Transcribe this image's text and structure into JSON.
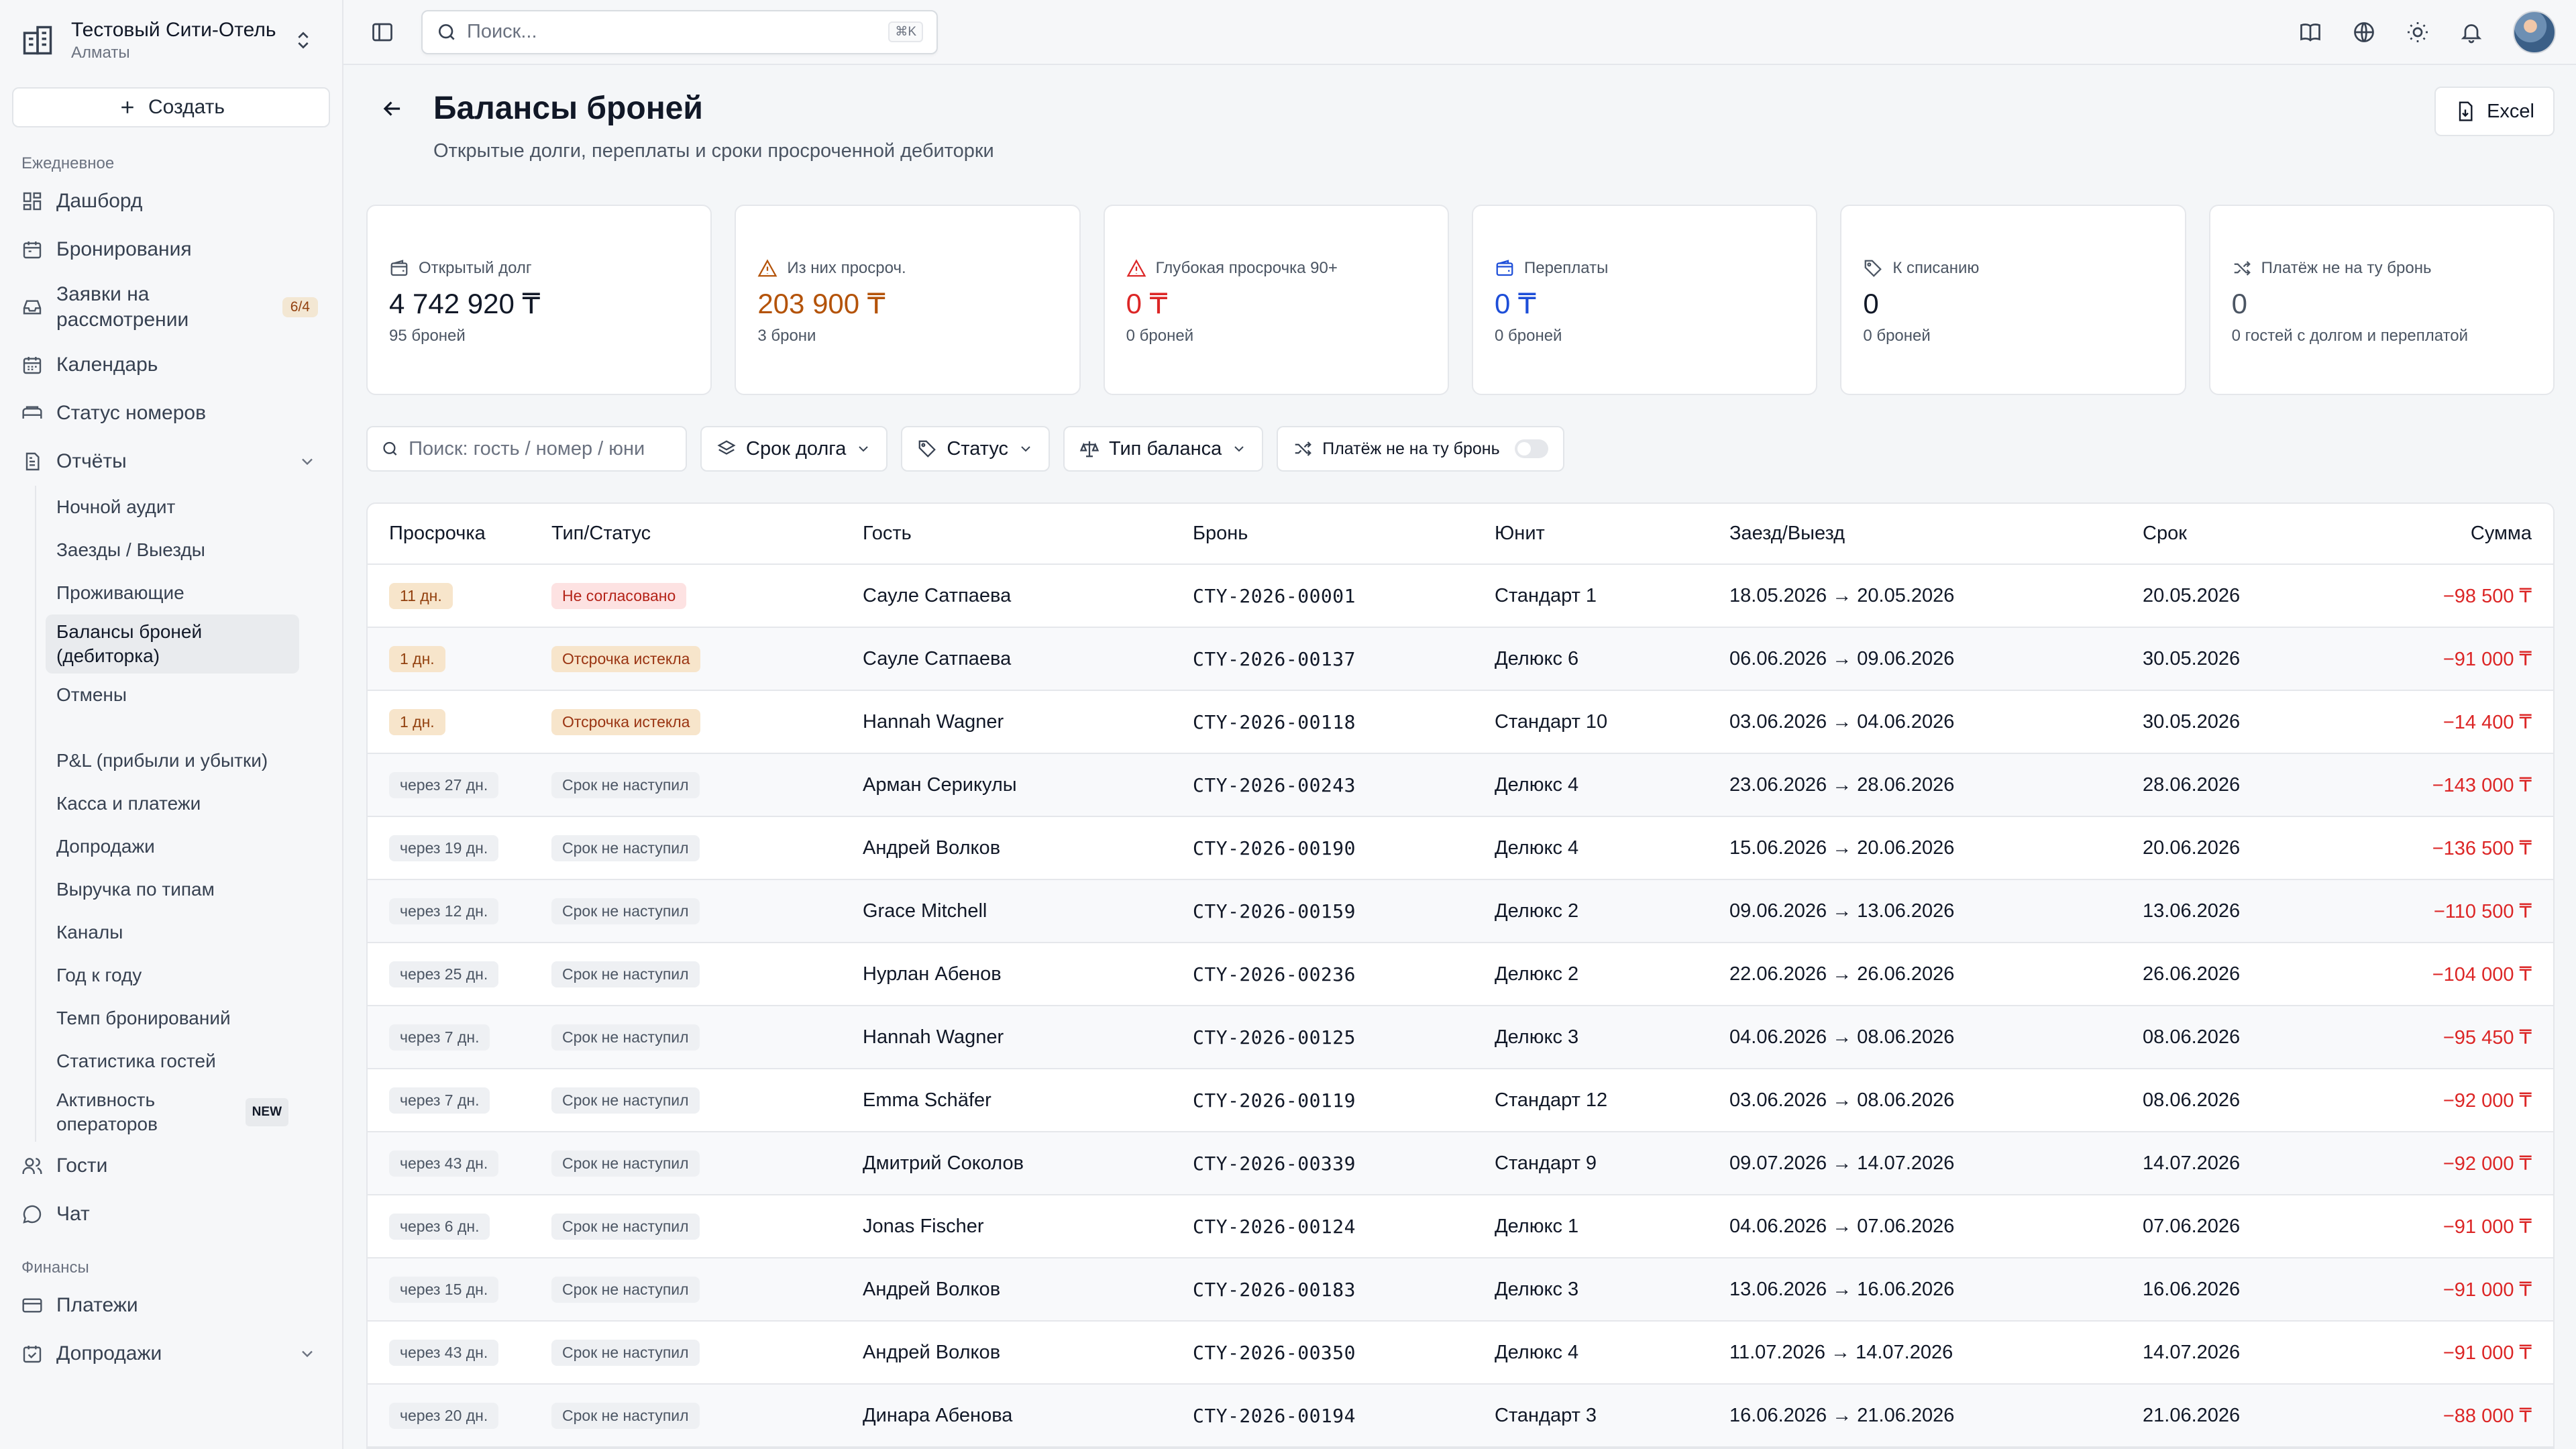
{
  "hotel": {
    "name": "Тестовый Сити-Отель",
    "city": "Алматы"
  },
  "sidebar": {
    "create_label": "Создать",
    "section_daily": "Ежедневное",
    "section_finance": "Финансы",
    "items": [
      {
        "label": "Дашборд",
        "icon": "dashboard-icon"
      },
      {
        "label": "Бронирования",
        "icon": "calendar-icon"
      },
      {
        "label": "Заявки на рассмотрении",
        "icon": "inbox-icon",
        "badge": "6/4"
      },
      {
        "label": "Календарь",
        "icon": "calendar-icon"
      },
      {
        "label": "Статус номеров",
        "icon": "bed-icon"
      },
      {
        "label": "Отчёты",
        "icon": "report-icon"
      }
    ],
    "reports": [
      "Ночной аудит",
      "Заезды / Выезды",
      "Проживающие",
      "Балансы броней (дебиторка)",
      "Отмены",
      "P&L (прибыли и убытки)",
      "Касса и платежи",
      "Допродажи",
      "Выручка по типам",
      "Каналы",
      "Год к году",
      "Темп бронирований",
      "Статистика гостей",
      "Активность операторов"
    ],
    "new_badge": "NEW",
    "bottom_items": [
      {
        "label": "Гости",
        "icon": "users-icon"
      },
      {
        "label": "Чат",
        "icon": "chat-icon"
      }
    ],
    "finance_items": [
      {
        "label": "Платежи",
        "icon": "card-icon"
      },
      {
        "label": "Допродажи",
        "icon": "cart-icon"
      }
    ]
  },
  "topbar": {
    "search_placeholder": "Поиск...",
    "shortcut": "⌘K"
  },
  "page": {
    "title": "Балансы броней",
    "subtitle": "Открытые долги, переплаты и сроки просроченной дебиторки",
    "excel_label": "Excel"
  },
  "kpis": [
    {
      "label": "Открытый долг",
      "value": "4 742 920 ₸",
      "sub": "95 броней",
      "color": "#111827",
      "icon": "wallet-icon"
    },
    {
      "label": "Из них просроч.",
      "value": "203 900 ₸",
      "sub": "3 брони",
      "color": "#b45309",
      "icon": "warning-icon"
    },
    {
      "label": "Глубокая просрочка 90+",
      "value": "0 ₸",
      "sub": "0 броней",
      "color": "#dc2626",
      "icon": "alert-icon"
    },
    {
      "label": "Переплаты",
      "value": "0 ₸",
      "sub": "0 броней",
      "color": "#1d4ed8",
      "icon": "wallet-blue-icon"
    },
    {
      "label": "К списанию",
      "value": "0",
      "sub": "0 броней",
      "color": "#111827",
      "icon": "tag-icon"
    },
    {
      "label": "Платёж не на ту бронь",
      "value": "0",
      "sub": "0 гостей с долгом и переплатой",
      "color": "#4b5563",
      "icon": "shuffle-icon"
    }
  ],
  "filters": {
    "search_placeholder": "Поиск: гость / номер / юни",
    "term": "Срок долга",
    "status": "Статус",
    "balance_type": "Тип баланса",
    "wrong_payment": "Платёж не на ту бронь"
  },
  "table": {
    "columns": [
      "Просрочка",
      "Тип/Статус",
      "Гость",
      "Бронь",
      "Юнит",
      "Заезд/Выезд",
      "Срок",
      "Сумма"
    ],
    "rows": [
      {
        "overdue": "11 дн.",
        "over": true,
        "status": "Не согласовано",
        "st": "red",
        "guest": "Сауле Сатпаева",
        "booking": "CTY-2026-00001",
        "unit": "Стандарт 1",
        "dates": "18.05.2026 → 20.05.2026",
        "due": "20.05.2026",
        "amount": "−98 500 ₸"
      },
      {
        "overdue": "1 дн.",
        "over": true,
        "status": "Отсрочка истекла",
        "st": "orange",
        "guest": "Сауле Сатпаева",
        "booking": "CTY-2026-00137",
        "unit": "Делюкс 6",
        "dates": "06.06.2026 → 09.06.2026",
        "due": "30.05.2026",
        "amount": "−91 000 ₸"
      },
      {
        "overdue": "1 дн.",
        "over": true,
        "status": "Отсрочка истекла",
        "st": "orange",
        "guest": "Hannah Wagner",
        "booking": "CTY-2026-00118",
        "unit": "Стандарт 10",
        "dates": "03.06.2026 → 04.06.2026",
        "due": "30.05.2026",
        "amount": "−14 400 ₸"
      },
      {
        "overdue": "через 27 дн.",
        "over": false,
        "status": "Срок не наступил",
        "st": "gray",
        "guest": "Арман Серикулы",
        "booking": "CTY-2026-00243",
        "unit": "Делюкс 4",
        "dates": "23.06.2026 → 28.06.2026",
        "due": "28.06.2026",
        "amount": "−143 000 ₸"
      },
      {
        "overdue": "через 19 дн.",
        "over": false,
        "status": "Срок не наступил",
        "st": "gray",
        "guest": "Андрей Волков",
        "booking": "CTY-2026-00190",
        "unit": "Делюкс 4",
        "dates": "15.06.2026 → 20.06.2026",
        "due": "20.06.2026",
        "amount": "−136 500 ₸"
      },
      {
        "overdue": "через 12 дн.",
        "over": false,
        "status": "Срок не наступил",
        "st": "gray",
        "guest": "Grace Mitchell",
        "booking": "CTY-2026-00159",
        "unit": "Делюкс 2",
        "dates": "09.06.2026 → 13.06.2026",
        "due": "13.06.2026",
        "amount": "−110 500 ₸"
      },
      {
        "overdue": "через 25 дн.",
        "over": false,
        "status": "Срок не наступил",
        "st": "gray",
        "guest": "Нурлан Абенов",
        "booking": "CTY-2026-00236",
        "unit": "Делюкс 2",
        "dates": "22.06.2026 → 26.06.2026",
        "due": "26.06.2026",
        "amount": "−104 000 ₸"
      },
      {
        "overdue": "через 7 дн.",
        "over": false,
        "status": "Срок не наступил",
        "st": "gray",
        "guest": "Hannah Wagner",
        "booking": "CTY-2026-00125",
        "unit": "Делюкс 3",
        "dates": "04.06.2026 → 08.06.2026",
        "due": "08.06.2026",
        "amount": "−95 450 ₸"
      },
      {
        "overdue": "через 7 дн.",
        "over": false,
        "status": "Срок не наступил",
        "st": "gray",
        "guest": "Emma Schäfer",
        "booking": "CTY-2026-00119",
        "unit": "Стандарт 12",
        "dates": "03.06.2026 → 08.06.2026",
        "due": "08.06.2026",
        "amount": "−92 000 ₸"
      },
      {
        "overdue": "через 43 дн.",
        "over": false,
        "status": "Срок не наступил",
        "st": "gray",
        "guest": "Дмитрий Соколов",
        "booking": "CTY-2026-00339",
        "unit": "Стандарт 9",
        "dates": "09.07.2026 → 14.07.2026",
        "due": "14.07.2026",
        "amount": "−92 000 ₸"
      },
      {
        "overdue": "через 6 дн.",
        "over": false,
        "status": "Срок не наступил",
        "st": "gray",
        "guest": "Jonas Fischer",
        "booking": "CTY-2026-00124",
        "unit": "Делюкс 1",
        "dates": "04.06.2026 → 07.06.2026",
        "due": "07.06.2026",
        "amount": "−91 000 ₸"
      },
      {
        "overdue": "через 15 дн.",
        "over": false,
        "status": "Срок не наступил",
        "st": "gray",
        "guest": "Андрей Волков",
        "booking": "CTY-2026-00183",
        "unit": "Делюкс 3",
        "dates": "13.06.2026 → 16.06.2026",
        "due": "16.06.2026",
        "amount": "−91 000 ₸"
      },
      {
        "overdue": "через 43 дн.",
        "over": false,
        "status": "Срок не наступил",
        "st": "gray",
        "guest": "Андрей Волков",
        "booking": "CTY-2026-00350",
        "unit": "Делюкс 4",
        "dates": "11.07.2026 → 14.07.2026",
        "due": "14.07.2026",
        "amount": "−91 000 ₸"
      },
      {
        "overdue": "через 20 дн.",
        "over": false,
        "status": "Срок не наступил",
        "st": "gray",
        "guest": "Динара Абенова",
        "booking": "CTY-2026-00194",
        "unit": "Стандарт 3",
        "dates": "16.06.2026 → 21.06.2026",
        "due": "21.06.2026",
        "amount": "−88 000 ₸"
      }
    ]
  }
}
